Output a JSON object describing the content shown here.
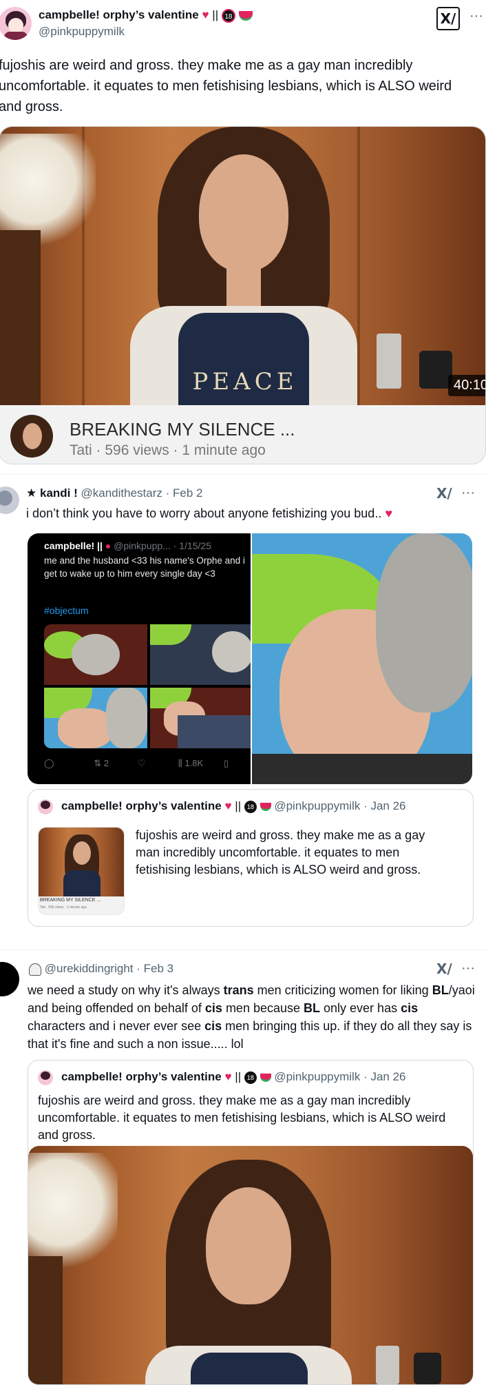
{
  "tweet1": {
    "name": "campbelle! orphy’s valentine",
    "name_suffix": "||",
    "handle": "@pinkpuppymilk",
    "text": "fujoshis are weird and gross. they make me as a gay man incredibly uncomfortable. it equates to men fetishising lesbians, which is ALSO weird and gross.",
    "video": {
      "duration": "40:10",
      "title": "BREAKING MY SILENCE ...",
      "meta": "Tati · 596 views · 1 minute ago",
      "shirt_text": "PEACE"
    }
  },
  "tweet2": {
    "star": "★",
    "name": "kandi !",
    "handle": "@kandithestarz",
    "date": "· Feb 2",
    "text": "i don’t think you have to worry about anyone fetishizing you bud..",
    "screenshot": {
      "name": "campbelle! ||",
      "handle": "@pinkpupp...",
      "date": "· 1/15/25",
      "text": "me and the husband <33 his name's Orphe and i get to wake up to him every single day <3",
      "hashtag": "#objectum",
      "retweets": "2",
      "views": "1.8K"
    },
    "quote": {
      "name": "campbelle! orphy’s valentine",
      "name_suffix": "||",
      "handle": "@pinkpuppymilk",
      "date": "· Jan 26",
      "text": "fujoshis are weird and gross. they make me as a gay man incredibly uncomfortable. it equates to men fetishising lesbians, which is ALSO weird and gross.",
      "thumb_title": "BREAKING MY SILENCE ...",
      "thumb_meta": "Tati · 596 views · 1 minute ago"
    }
  },
  "tweet3": {
    "handle": "@urekiddingright",
    "date": "· Feb 3",
    "text_parts": [
      {
        "t": "we need a study on why it's always ",
        "b": false
      },
      {
        "t": "trans",
        "b": true
      },
      {
        "t": " men criticizing women for liking ",
        "b": false
      },
      {
        "t": "BL",
        "b": true
      },
      {
        "t": "/yaoi and being offended on behalf of ",
        "b": false
      },
      {
        "t": "cis",
        "b": true
      },
      {
        "t": " men because ",
        "b": false
      },
      {
        "t": "BL",
        "b": true
      },
      {
        "t": " only ever has ",
        "b": false
      },
      {
        "t": "cis",
        "b": true
      },
      {
        "t": " characters and i never ever see ",
        "b": false
      },
      {
        "t": "cis",
        "b": true
      },
      {
        "t": " men bringing this up. if they do all they say is that it's fine and such a non issue..... lol",
        "b": false
      }
    ],
    "quote": {
      "name": "campbelle! orphy’s valentine",
      "name_suffix": "||",
      "handle": "@pinkpuppymilk",
      "date": "· Jan 26",
      "text": "fujoshis are weird and gross. they make me as a gay man incredibly uncomfortable. it equates to men fetishising lesbians, which is ALSO weird and gross."
    }
  },
  "icons": {
    "grok": "x-grok-icon",
    "more": "···",
    "heart": "red-heart-icon",
    "broken_heart": "broken-heart-icon",
    "eighteen": "18",
    "watermelon": "watermelon-icon"
  },
  "colors": {
    "link": "#1d9bf0",
    "muted": "#536471",
    "heart": "#e0245e"
  }
}
